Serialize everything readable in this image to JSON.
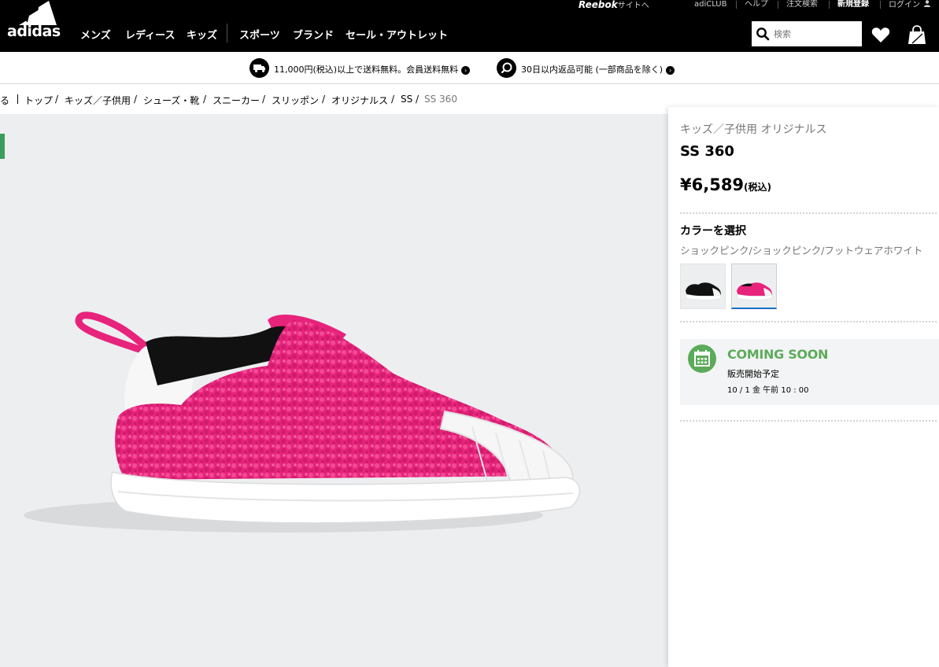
{
  "topbar": {
    "reebok_brand": "Reebok",
    "reebok_suffix": "サイトへ",
    "adiclub": "adiCLUB",
    "help": "ヘルプ",
    "order_search": "注文検索",
    "register": "新規登録",
    "login": "ログイン"
  },
  "header": {
    "logo_text": "adidas",
    "nav": [
      "メンズ",
      "レディース",
      "キッズ",
      "スポーツ",
      "ブランド",
      "セール・アウトレット"
    ],
    "search_placeholder": "検索",
    "icons": [
      "search-icon",
      "heart-icon",
      "shopping-bag-icon"
    ]
  },
  "benefits": {
    "shipping": "11,000円(税込)以上で送料無料。会員送料無料",
    "returns": "30日以内返品可能 (一部商品を除く)",
    "icons": [
      "truck-icon",
      "return-icon",
      "chevron-right-icon"
    ]
  },
  "breadcrumb": {
    "back": "戻る",
    "items": [
      "トップ",
      "キッズ／子供用",
      "シューズ・靴",
      "スニーカー",
      "スリッポン",
      "オリジナルス",
      "SS",
      "SS 360"
    ]
  },
  "product": {
    "category": "キッズ／子供用 オリジナルス",
    "name": "SS 360",
    "price": "¥6,589",
    "tax_label": "(税込)",
    "color_heading": "カラーを選択",
    "color_name": "ショックピンク/ショックピンク/フットウェアホワイト",
    "swatches": [
      {
        "name": "black",
        "color": "#111111"
      },
      {
        "name": "pink",
        "color": "#e8237c"
      }
    ],
    "selected_swatch": 1,
    "coming_title": "COMING SOON",
    "coming_sub": "販売開始予定",
    "coming_date": "10 / 1 金 午前 10 : 00"
  },
  "colors": {
    "brand_black": "#000000",
    "accent_green": "#5cab5a",
    "shoe_pink": "#e8237c",
    "selected_blue": "#1b6fc9"
  }
}
